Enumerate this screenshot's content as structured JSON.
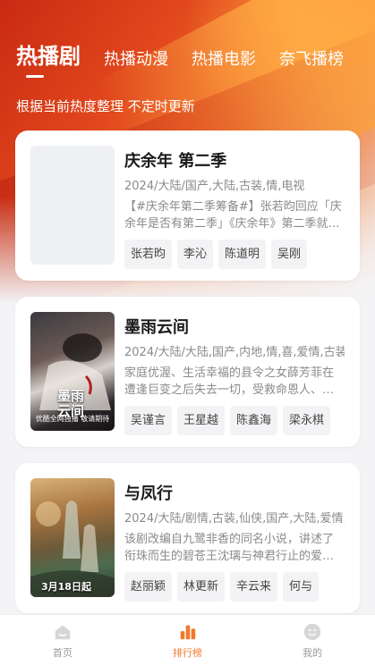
{
  "header": {
    "tabs": [
      {
        "label": "热播剧",
        "active": true
      },
      {
        "label": "热播动漫",
        "active": false
      },
      {
        "label": "热播电影",
        "active": false
      },
      {
        "label": "奈飞播榜",
        "active": false
      }
    ],
    "subtitle": "根据当前热度整理 不定时更新"
  },
  "shows": [
    {
      "title": "庆余年 第二季",
      "meta": "2024/大陆/国产,大陆,古装,情,电视",
      "desc": "【#庆余年第二季筹备#】张若昀回应「庆余年是否有第二季」《庆余年》第二季就在路上，敬请期待",
      "actors": [
        "张若昀",
        "李沁",
        "陈道明",
        "吴刚"
      ],
      "poster": {
        "icon": "poster-placeholder"
      }
    },
    {
      "title": "墨雨云间",
      "meta": "2024/大陆/大陆,国产,内地,情,喜,爱情,古装",
      "desc": "家庭优渥、生活幸福的县令之女薛芳菲在遭逢巨变之后失去一切，受救命恩人、…",
      "actors": [
        "吴谨言",
        "王星越",
        "陈鑫海",
        "梁永棋"
      ],
      "poster": {
        "big_text": "墨雨\n云间",
        "caption": "优酷全网独播 敬请期待"
      }
    },
    {
      "title": "与凤行",
      "meta": "2024/大陆/剧情,古装,仙侠,国产,大陆,爱情,",
      "desc": "该剧改编自九鹭非香的同名小说，讲述了衔珠而生的碧苍王沈璃与神君行止的爱…",
      "actors": [
        "赵丽颖",
        "林更新",
        "辛云来",
        "何与"
      ],
      "poster": {
        "date": "3月18日起"
      }
    }
  ],
  "bottom_nav": [
    {
      "label": "首页",
      "icon": "home-icon",
      "active": false
    },
    {
      "label": "排行榜",
      "icon": "ranking-icon",
      "active": true
    },
    {
      "label": "我的",
      "icon": "profile-icon",
      "active": false
    }
  ],
  "colors": {
    "accent": "#f07a2e",
    "hero": "#e0461c"
  }
}
